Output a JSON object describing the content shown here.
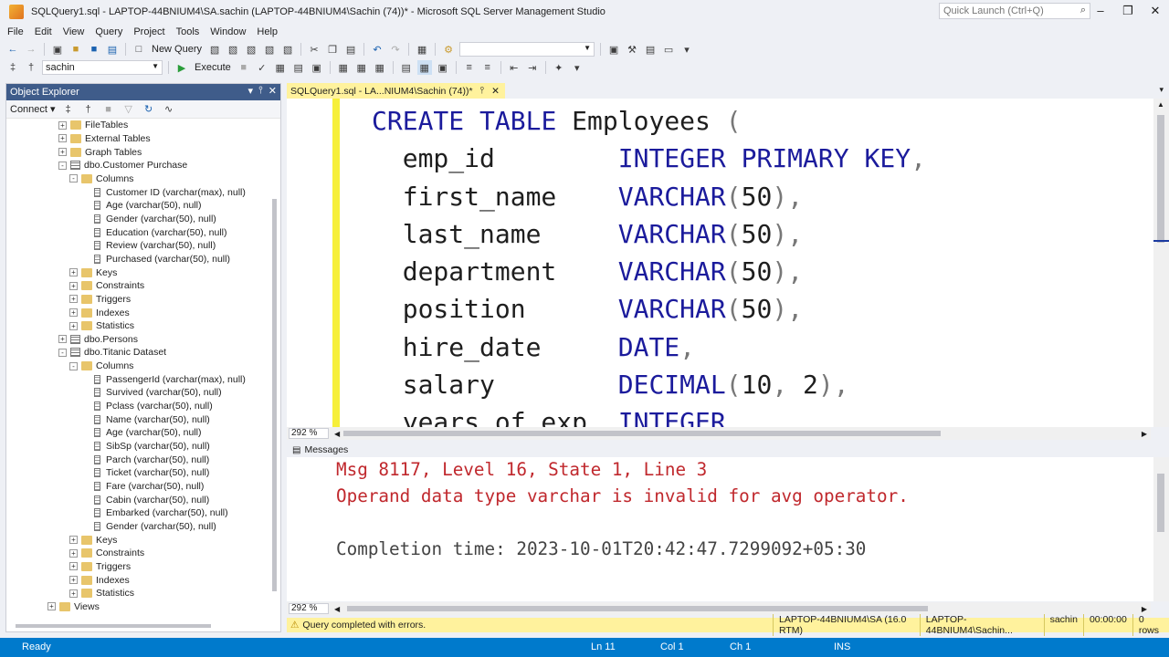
{
  "window": {
    "title": "SQLQuery1.sql - LAPTOP-44BNIUM4\\SA.sachin (LAPTOP-44BNIUM4\\Sachin (74))* - Microsoft SQL Server Management Studio",
    "quick_launch_placeholder": "Quick Launch (Ctrl+Q)"
  },
  "menu": [
    "File",
    "Edit",
    "View",
    "Query",
    "Project",
    "Tools",
    "Window",
    "Help"
  ],
  "toolbar": {
    "new_query_label": "New Query",
    "database": "sachin",
    "execute_label": "Execute"
  },
  "object_explorer": {
    "title": "Object Explorer",
    "connect_label": "Connect",
    "nodes": [
      {
        "label": "FileTables",
        "indent": 0,
        "icon": "folder",
        "exp": "+"
      },
      {
        "label": "External Tables",
        "indent": 0,
        "icon": "folder",
        "exp": "+"
      },
      {
        "label": "Graph Tables",
        "indent": 0,
        "icon": "folder",
        "exp": "+"
      },
      {
        "label": "dbo.Customer Purchase",
        "indent": 0,
        "icon": "table",
        "exp": "-"
      },
      {
        "label": "Columns",
        "indent": 1,
        "icon": "folder",
        "exp": "-"
      },
      {
        "label": "Customer ID (varchar(max), null)",
        "indent": 2,
        "icon": "column",
        "exp": ""
      },
      {
        "label": "Age (varchar(50), null)",
        "indent": 2,
        "icon": "column",
        "exp": ""
      },
      {
        "label": "Gender (varchar(50), null)",
        "indent": 2,
        "icon": "column",
        "exp": ""
      },
      {
        "label": "Education (varchar(50), null)",
        "indent": 2,
        "icon": "column",
        "exp": ""
      },
      {
        "label": "Review (varchar(50), null)",
        "indent": 2,
        "icon": "column",
        "exp": ""
      },
      {
        "label": "Purchased (varchar(50), null)",
        "indent": 2,
        "icon": "column",
        "exp": ""
      },
      {
        "label": "Keys",
        "indent": 1,
        "icon": "folder",
        "exp": "+"
      },
      {
        "label": "Constraints",
        "indent": 1,
        "icon": "folder",
        "exp": "+"
      },
      {
        "label": "Triggers",
        "indent": 1,
        "icon": "folder",
        "exp": "+"
      },
      {
        "label": "Indexes",
        "indent": 1,
        "icon": "folder",
        "exp": "+"
      },
      {
        "label": "Statistics",
        "indent": 1,
        "icon": "folder",
        "exp": "+"
      },
      {
        "label": "dbo.Persons",
        "indent": 0,
        "icon": "table",
        "exp": "+"
      },
      {
        "label": "dbo.Titanic Dataset",
        "indent": 0,
        "icon": "table",
        "exp": "-"
      },
      {
        "label": "Columns",
        "indent": 1,
        "icon": "folder",
        "exp": "-"
      },
      {
        "label": "PassengerId (varchar(max), null)",
        "indent": 2,
        "icon": "column",
        "exp": ""
      },
      {
        "label": "Survived (varchar(50), null)",
        "indent": 2,
        "icon": "column",
        "exp": ""
      },
      {
        "label": "Pclass (varchar(50), null)",
        "indent": 2,
        "icon": "column",
        "exp": ""
      },
      {
        "label": "Name (varchar(50), null)",
        "indent": 2,
        "icon": "column",
        "exp": ""
      },
      {
        "label": "Age (varchar(50), null)",
        "indent": 2,
        "icon": "column",
        "exp": ""
      },
      {
        "label": "SibSp (varchar(50), null)",
        "indent": 2,
        "icon": "column",
        "exp": ""
      },
      {
        "label": "Parch (varchar(50), null)",
        "indent": 2,
        "icon": "column",
        "exp": ""
      },
      {
        "label": "Ticket (varchar(50), null)",
        "indent": 2,
        "icon": "column",
        "exp": ""
      },
      {
        "label": "Fare (varchar(50), null)",
        "indent": 2,
        "icon": "column",
        "exp": ""
      },
      {
        "label": "Cabin (varchar(50), null)",
        "indent": 2,
        "icon": "column",
        "exp": ""
      },
      {
        "label": "Embarked (varchar(50), null)",
        "indent": 2,
        "icon": "column",
        "exp": ""
      },
      {
        "label": "Gender (varchar(50), null)",
        "indent": 2,
        "icon": "column",
        "exp": ""
      },
      {
        "label": "Keys",
        "indent": 1,
        "icon": "folder",
        "exp": "+"
      },
      {
        "label": "Constraints",
        "indent": 1,
        "icon": "folder",
        "exp": "+"
      },
      {
        "label": "Triggers",
        "indent": 1,
        "icon": "folder",
        "exp": "+"
      },
      {
        "label": "Indexes",
        "indent": 1,
        "icon": "folder",
        "exp": "+"
      },
      {
        "label": "Statistics",
        "indent": 1,
        "icon": "folder",
        "exp": "+"
      },
      {
        "label": "Views",
        "indent": -1,
        "icon": "folder",
        "exp": "+"
      }
    ]
  },
  "editor": {
    "tab_label": "SQLQuery1.sql - LA...NIUM4\\Sachin (74))*",
    "zoom": "292 %",
    "code_lines": [
      "CREATE TABLE Employees (",
      "  emp_id        INTEGER PRIMARY KEY,",
      "  first_name    VARCHAR(50),",
      "  last_name     VARCHAR(50),",
      "  department    VARCHAR(50),",
      "  position      VARCHAR(50),",
      "  hire_date     DATE,",
      "  salary        DECIMAL(10, 2),",
      "  years_of_exp  INTEGER"
    ]
  },
  "messages": {
    "tab_label": "Messages",
    "zoom": "292 %",
    "error_line1": "Msg 8117, Level 16, State 1, Line 3",
    "error_line2": "Operand data type varchar is invalid for avg operator.",
    "completion": "Completion time: 2023-10-01T20:42:47.7299092+05:30"
  },
  "query_status": {
    "text": "Query completed with errors.",
    "server": "LAPTOP-44BNIUM4\\SA (16.0 RTM)",
    "login": "LAPTOP-44BNIUM4\\Sachin...",
    "database": "sachin",
    "elapsed": "00:00:00",
    "rows": "0 rows"
  },
  "statusbar": {
    "ready": "Ready",
    "ln": "Ln 11",
    "col": "Col 1",
    "ch": "Ch 1",
    "mode": "INS"
  }
}
